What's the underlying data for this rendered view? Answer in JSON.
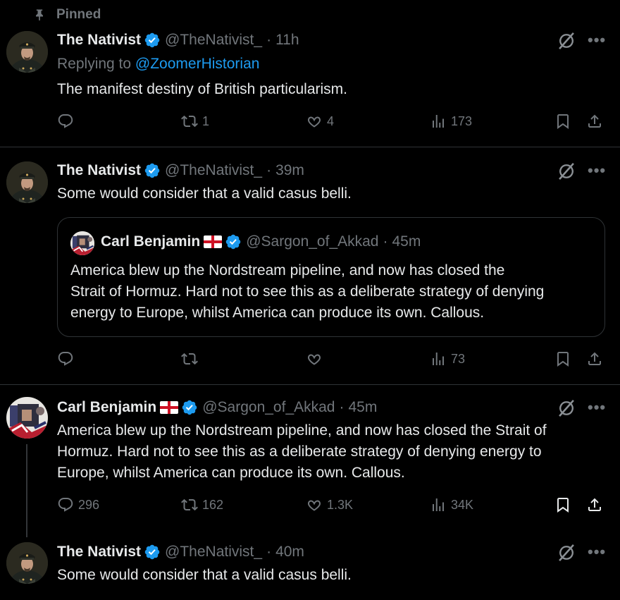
{
  "pinned_label": "Pinned",
  "tweets": [
    {
      "name": "The Nativist",
      "handle": "@TheNativist_",
      "sep": "·",
      "time": "11h",
      "reply_prefix": "Replying to",
      "reply_handle": "@ZoomerHistorian",
      "text": "The manifest destiny of British particularism.",
      "retweets": "1",
      "likes": "4",
      "views": "173"
    },
    {
      "name": "The Nativist",
      "handle": "@TheNativist_",
      "sep": "·",
      "time": "39m",
      "text": "Some would consider that a valid casus belli.",
      "quote": {
        "name": "Carl Benjamin",
        "handle": "@Sargon_of_Akkad",
        "sep": "·",
        "time": "45m",
        "lines": [
          "America blew up the Nordstream pipeline, and now has closed the",
          "Strait of Hormuz. Hard not to see this as a deliberate strategy of denying",
          "energy to Europe, whilst America can produce its own. Callous."
        ]
      },
      "views": "73"
    },
    {
      "name": "Carl Benjamin",
      "handle": "@Sargon_of_Akkad",
      "sep": "·",
      "time": "45m",
      "lines": [
        "America blew up the Nordstream pipeline, and now has closed the Strait of",
        "Hormuz. Hard not to see this as a deliberate strategy of denying energy to",
        "Europe, whilst America can produce its own. Callous."
      ],
      "replies": "296",
      "retweets": "162",
      "likes": "1.3K",
      "views": "34K"
    },
    {
      "name": "The Nativist",
      "handle": "@TheNativist_",
      "sep": "·",
      "time": "40m",
      "text": "Some would consider that a valid casus belli."
    }
  ],
  "more_label": "•••",
  "colors": {
    "accent": "#1d9bf0",
    "muted": "#71767b",
    "verified": "#1d9bf0"
  }
}
